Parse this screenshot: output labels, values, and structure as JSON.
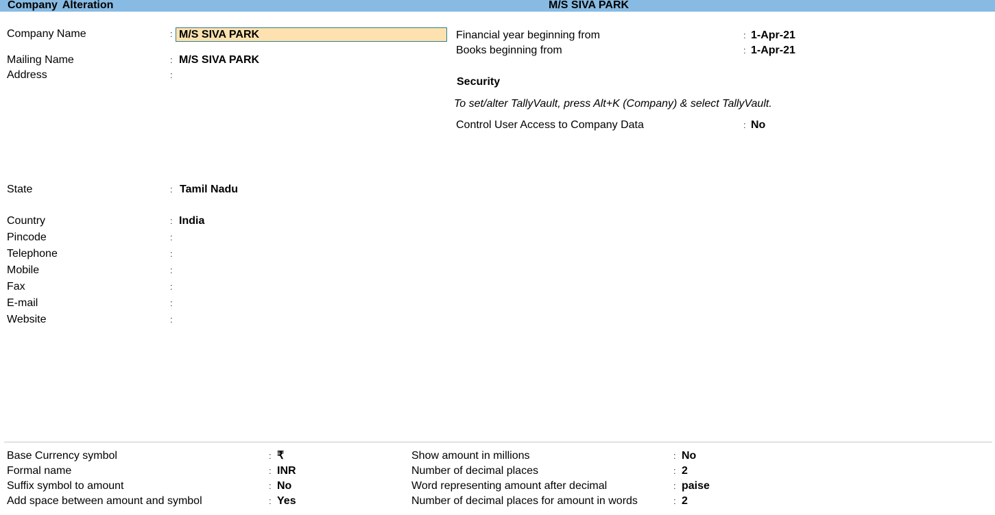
{
  "header": {
    "title": "Company  Alteration",
    "company": "M/S SIVA PARK"
  },
  "left": {
    "company_name": {
      "label": "Company Name",
      "value": "M/S SIVA PARK"
    },
    "mailing_name": {
      "label": "Mailing Name",
      "value": "M/S SIVA PARK"
    },
    "address": {
      "label": "Address",
      "value": ""
    },
    "state": {
      "label": "State",
      "value": "Tamil Nadu"
    },
    "country": {
      "label": "Country",
      "value": "India"
    },
    "pincode": {
      "label": "Pincode",
      "value": ""
    },
    "telephone": {
      "label": "Telephone",
      "value": ""
    },
    "mobile": {
      "label": "Mobile",
      "value": ""
    },
    "fax": {
      "label": "Fax",
      "value": ""
    },
    "email": {
      "label": "E-mail",
      "value": ""
    },
    "website": {
      "label": "Website",
      "value": ""
    }
  },
  "right": {
    "fy_begin": {
      "label": "Financial year beginning from",
      "value": "1-Apr-21"
    },
    "books_begin": {
      "label": "Books beginning from",
      "value": "1-Apr-21"
    },
    "security_heading": "Security",
    "tallyvault_note": "To set/alter TallyVault, press Alt+K (Company) & select TallyVault.",
    "control_access": {
      "label": "Control User Access to Company Data",
      "value": "No"
    }
  },
  "currency": {
    "base_symbol": {
      "label": "Base Currency symbol",
      "value": "₹"
    },
    "formal_name": {
      "label": "Formal name",
      "value": "INR"
    },
    "suffix_symbol": {
      "label": "Suffix symbol to amount",
      "value": "No"
    },
    "add_space": {
      "label": "Add space between amount and symbol",
      "value": "Yes"
    },
    "show_millions": {
      "label": "Show amount in millions",
      "value": "No"
    },
    "decimal_places": {
      "label": "Number of decimal places",
      "value": "2"
    },
    "word_after_decimal": {
      "label": "Word representing amount after decimal",
      "value": "paise"
    },
    "decimal_places_words": {
      "label": "Number of decimal places for amount in words",
      "value": "2"
    }
  },
  "colon": ":"
}
